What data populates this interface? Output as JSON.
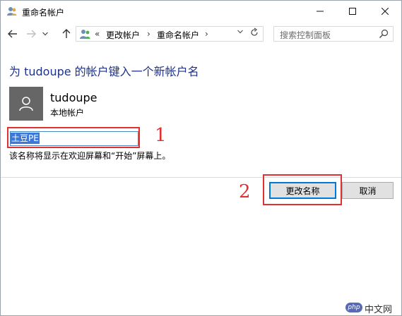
{
  "window": {
    "title": "重命名帐户",
    "icon": "user-accounts-icon",
    "controls": {
      "minimize": "minimize-icon",
      "maximize": "maximize-icon",
      "close": "close-icon"
    }
  },
  "nav": {
    "back_icon": "back-arrow-icon",
    "forward_icon": "forward-arrow-icon",
    "recent_icon": "chevron-down-icon",
    "up_icon": "up-arrow-icon",
    "breadcrumb_overflow": "«",
    "breadcrumb": [
      "更改帐户",
      "重命名帐户"
    ],
    "breadcrumb_separator": "›",
    "refresh_icon": "refresh-icon",
    "search_placeholder": "搜索控制面板"
  },
  "main": {
    "heading": "为 tudoupe 的帐户键入一个新帐户名",
    "user_name": "tudoupe",
    "user_type": "本地帐户",
    "new_name_value": "土豆PE",
    "hint": "该名称将显示在欢迎屏幕和“开始”屏幕上。"
  },
  "buttons": {
    "primary": "更改名称",
    "cancel": "取消"
  },
  "annotations": {
    "step1": "1",
    "step2": "2",
    "color": "#e03030"
  },
  "watermark": {
    "logo": "php",
    "text": "中文网"
  },
  "colors": {
    "heading": "#1e3287",
    "selection": "#3c78d7",
    "primary_button_border": "#0078d7",
    "avatar_bg": "#666666"
  }
}
